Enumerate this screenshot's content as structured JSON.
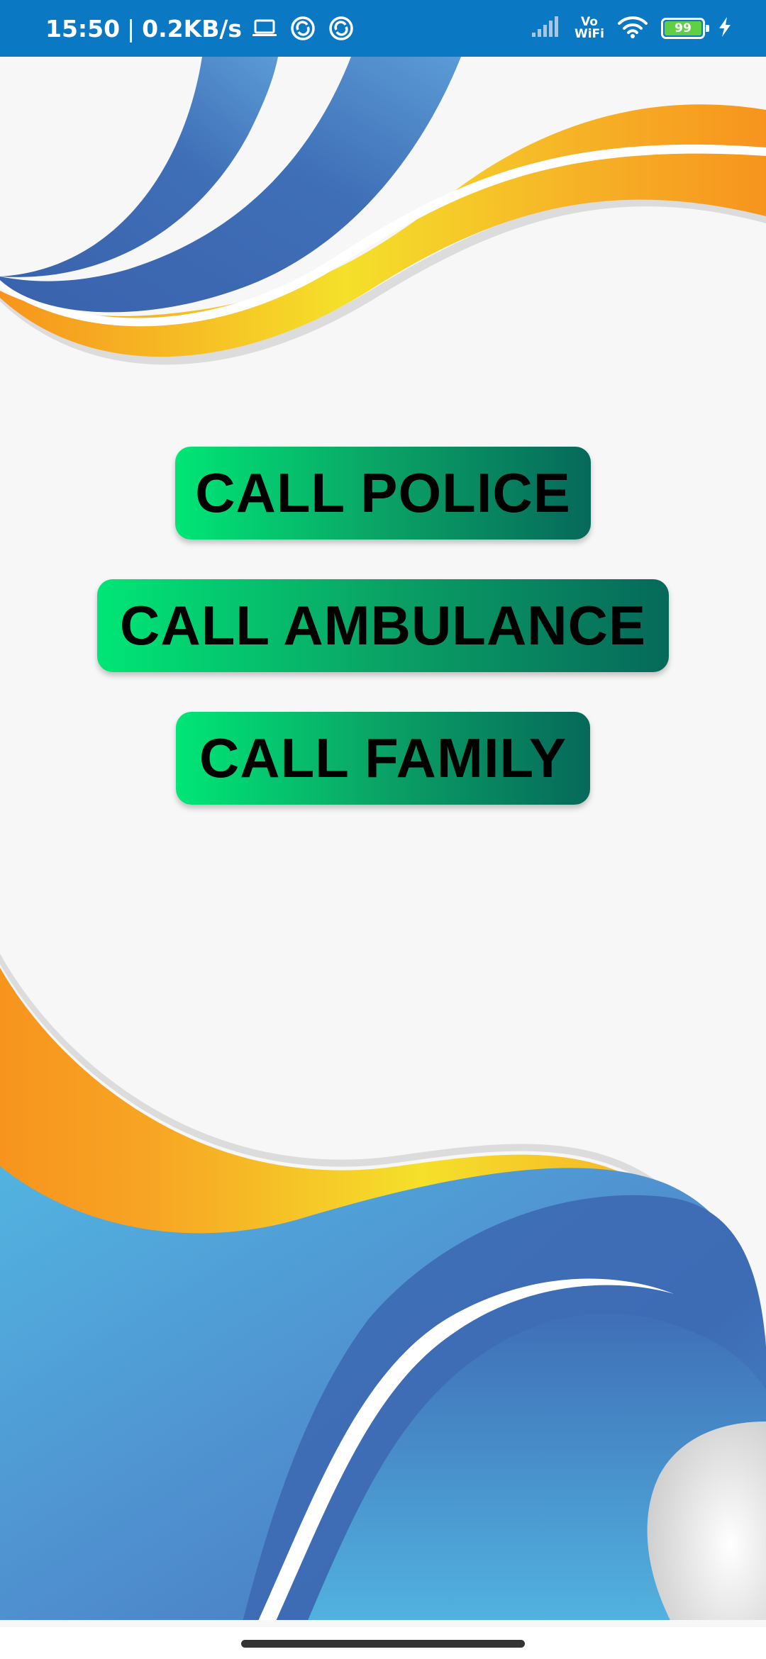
{
  "status_bar": {
    "time": "15:50",
    "separator": "|",
    "network_speed": "0.2KB/s",
    "icons": [
      "laptop-icon",
      "sync-icon",
      "sync-icon",
      "signal-icon",
      "vowifi-icon",
      "wifi-icon",
      "battery-icon",
      "charging-icon"
    ],
    "vowifi_top": "Vo",
    "vowifi_bottom": "WiFi",
    "battery_level": "99",
    "background_color": "#0a78c2"
  },
  "buttons": {
    "police_label": "CALL POLICE",
    "ambulance_label": "CALL AMBULANCE",
    "family_label": "CALL FAMILY"
  },
  "theme": {
    "button_gradient": [
      "#00e676",
      "#06695a"
    ],
    "wave_blue": "#3f6fb7",
    "wave_light_blue": "#52b3e0",
    "wave_orange": "#f7941d",
    "wave_yellow": "#f5e02a",
    "background": "#f7f7f7"
  }
}
